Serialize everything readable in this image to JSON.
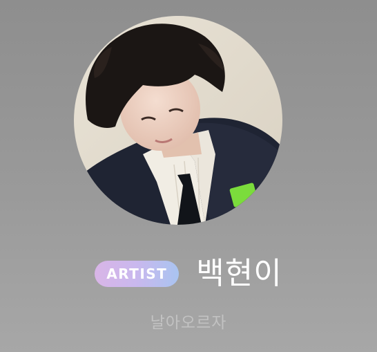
{
  "profile": {
    "badge_label": "ARTIST",
    "name": "백현이",
    "status": "날아오르자"
  },
  "colors": {
    "background": "#9a9a9a",
    "badge_gradient_start": "#d9b5e7",
    "badge_gradient_end": "#a9c4f0",
    "name_text": "#ffffff",
    "status_text": "#c2c2c2"
  }
}
